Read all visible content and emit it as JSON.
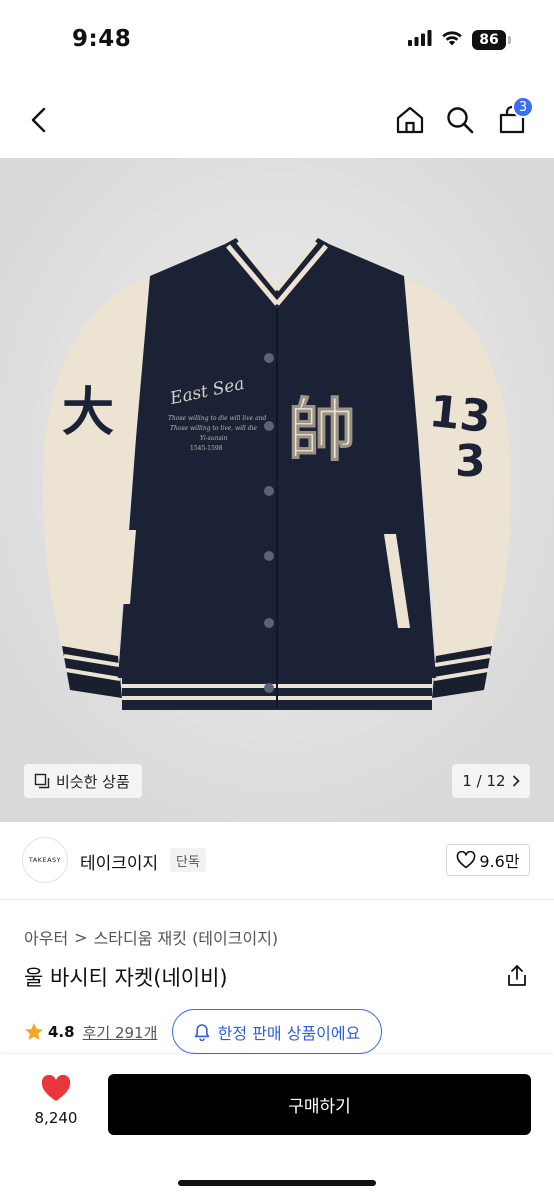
{
  "status_bar": {
    "time": "9:48",
    "battery": "86",
    "icons": [
      "signal-icon",
      "wifi-icon",
      "battery-icon"
    ]
  },
  "header": {
    "cart_count": "3",
    "icons": [
      "back-arrow-icon",
      "home-icon",
      "search-icon",
      "cart-icon"
    ],
    "accent_color": "#3b6ef5"
  },
  "gallery": {
    "similar_label": "비슷한 상품",
    "pager_label": "1 / 12",
    "image_text": {
      "chest_script": "East Sea",
      "chest_small": [
        "Those willing to die will live and",
        "Those willing to live, will die",
        "Yi-sunsin",
        "1545-1598"
      ],
      "chest_patch": "帥",
      "sleeve_number": "13"
    }
  },
  "brand": {
    "logo_text": "TAKEASY",
    "name": "테이크이지",
    "badge": "단독",
    "likes": "9.6만"
  },
  "product": {
    "breadcrumb": [
      "아우터",
      "스타디움 재킷 (테이크이지)"
    ],
    "title": "울 바시티 자켓(네이비)",
    "rating": "4.8",
    "reviews": "후기 291개",
    "limited_label": "한정 판매 상품이에요"
  },
  "bottom_bar": {
    "like_count": "8,240",
    "buy_label": "구매하기",
    "heart_color": "#e8363a"
  }
}
